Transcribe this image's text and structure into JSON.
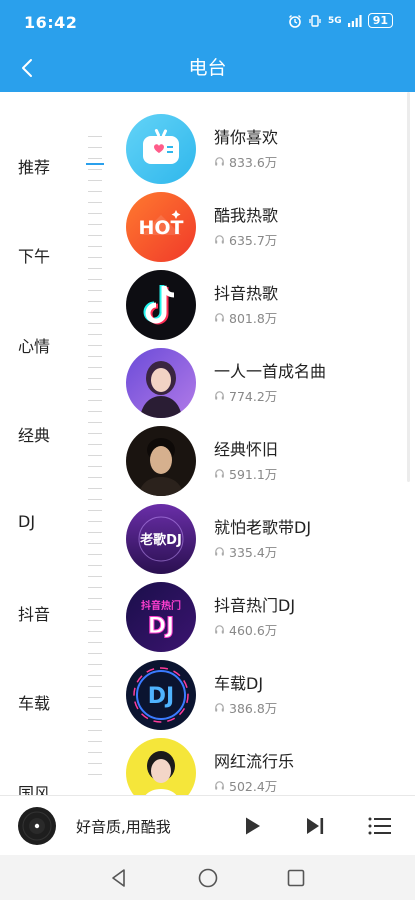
{
  "status_bar": {
    "time": "16:42",
    "network": "5G",
    "battery": "91",
    "icons": [
      "alarm-icon",
      "vibrate-icon",
      "signal-icon",
      "battery-icon"
    ]
  },
  "header": {
    "title": "电台",
    "back_icon": "chevron-left-icon"
  },
  "categories": [
    {
      "label": "推荐",
      "active": true
    },
    {
      "label": "下午",
      "active": false
    },
    {
      "label": "心情",
      "active": false
    },
    {
      "label": "经典",
      "active": false
    },
    {
      "label": "DJ",
      "active": false
    },
    {
      "label": "抖音",
      "active": false
    },
    {
      "label": "车载",
      "active": false
    },
    {
      "label": "国风",
      "active": false
    }
  ],
  "stations": [
    {
      "title": "猜你喜欢",
      "plays": "833.6万"
    },
    {
      "title": "酷我热歌",
      "plays": "635.7万",
      "cover_text": "HOT"
    },
    {
      "title": "抖音热歌",
      "plays": "801.8万"
    },
    {
      "title": "一人一首成名曲",
      "plays": "774.2万"
    },
    {
      "title": "经典怀旧",
      "plays": "591.1万"
    },
    {
      "title": "就怕老歌带DJ",
      "plays": "335.4万",
      "cover_text": "老歌DJ"
    },
    {
      "title": "抖音热门DJ",
      "plays": "460.6万",
      "cover_text": "抖音热门",
      "cover_text2": "DJ"
    },
    {
      "title": "车载DJ",
      "plays": "386.8万",
      "cover_text": "DJ"
    },
    {
      "title": "网红流行乐",
      "plays": "502.4万"
    }
  ],
  "player": {
    "title": "好音质,用酷我"
  },
  "colors": {
    "brand_blue": "#2aa0ec",
    "text_primary": "#222222",
    "text_secondary": "#888888"
  }
}
